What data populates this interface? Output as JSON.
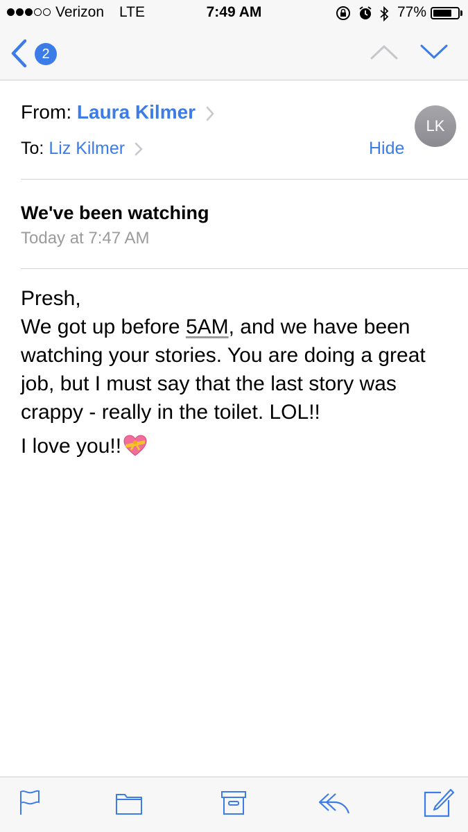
{
  "status_bar": {
    "carrier": "Verizon",
    "network": "LTE",
    "time": "7:49 AM",
    "battery_percent": "77%",
    "battery_level": 0.77,
    "icons": [
      "orientation-lock-icon",
      "alarm-icon",
      "bluetooth-icon"
    ]
  },
  "nav": {
    "back_badge": "2"
  },
  "email": {
    "from_label": "From:",
    "from_name": "Laura Kilmer",
    "to_label": "To:",
    "to_name": "Liz Kilmer",
    "avatar_initials": "LK",
    "hide_label": "Hide",
    "subject": "We've been watching",
    "date": "Today at 7:47 AM",
    "body": {
      "greeting": "Presh,",
      "para_pre": "We got up before ",
      "para_link": "5AM",
      "para_post": ", and we have been watching your stories.  You are doing a great job, but I must say that the last story was crappy - really in the toilet.  LOL!!",
      "closing": "I love you!!"
    }
  },
  "toolbar": {
    "icons": [
      "flag-icon",
      "folder-icon",
      "archive-icon",
      "reply-icon",
      "compose-icon"
    ]
  },
  "colors": {
    "accent": "#3b7ce8",
    "muted": "#9b9b9b",
    "bar_bg": "#f7f7f7"
  }
}
